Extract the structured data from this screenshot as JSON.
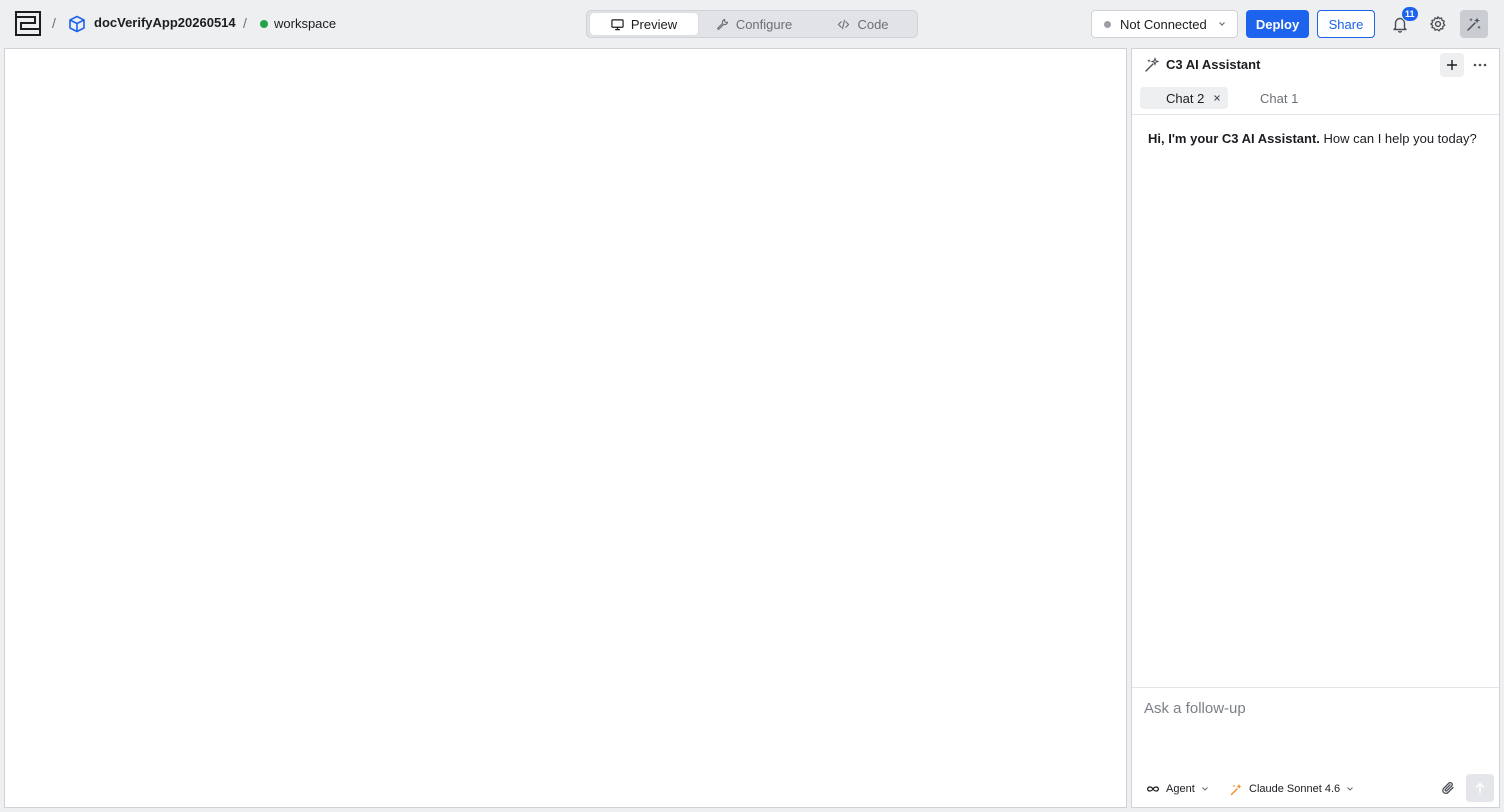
{
  "header": {
    "separator": "/",
    "project_name": "docVerifyApp20260514",
    "workspace_name": "workspace",
    "modes": [
      {
        "label": "Preview",
        "icon": "monitor-icon",
        "active": true
      },
      {
        "label": "Configure",
        "icon": "wrench-icon",
        "active": false
      },
      {
        "label": "Code",
        "icon": "code-icon",
        "active": false
      }
    ],
    "connection_status": "Not Connected",
    "deploy_label": "Deploy",
    "share_label": "Share",
    "notification_count": "11"
  },
  "assistant": {
    "title": "C3 AI Assistant",
    "tabs": [
      {
        "label": "Chat 2",
        "active": true
      },
      {
        "label": "Chat 1",
        "active": false
      }
    ],
    "greeting_bold": "Hi, I'm your C3 AI Assistant.",
    "greeting_rest": " How can I help you today?",
    "input_placeholder": "Ask a follow-up",
    "agent_mode": "Agent",
    "model": "Claude Sonnet 4.6"
  },
  "colors": {
    "accent": "#1d63ed",
    "status_green": "#22a34a",
    "status_gray": "#9a9ea5",
    "model_orange": "#f08a24"
  }
}
